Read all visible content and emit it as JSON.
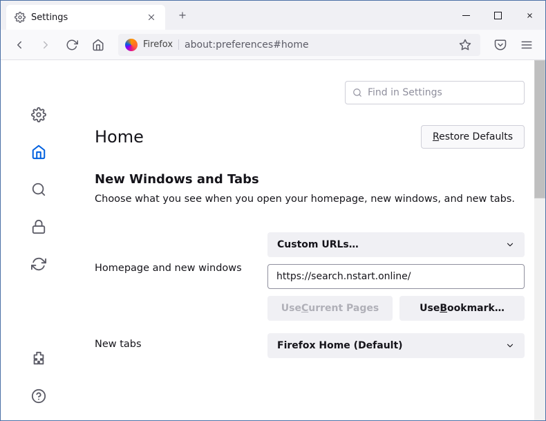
{
  "tab": {
    "title": "Settings"
  },
  "urlbar": {
    "label": "Firefox",
    "url": "about:preferences#home"
  },
  "search": {
    "placeholder": "Find in Settings"
  },
  "page": {
    "title": "Home"
  },
  "buttons": {
    "restore": "Restore Defaults",
    "use_current": "Use Current Pages",
    "use_bookmark": "Use Bookmark…"
  },
  "section": {
    "new_windows_title": "New Windows and Tabs",
    "new_windows_desc": "Choose what you see when you open your homepage, new windows, and new tabs."
  },
  "homepage": {
    "label": "Homepage and new windows",
    "select_value": "Custom URLs…",
    "url_value": "https://search.nstart.online/"
  },
  "newtabs": {
    "label": "New tabs",
    "select_value": "Firefox Home (Default)"
  }
}
